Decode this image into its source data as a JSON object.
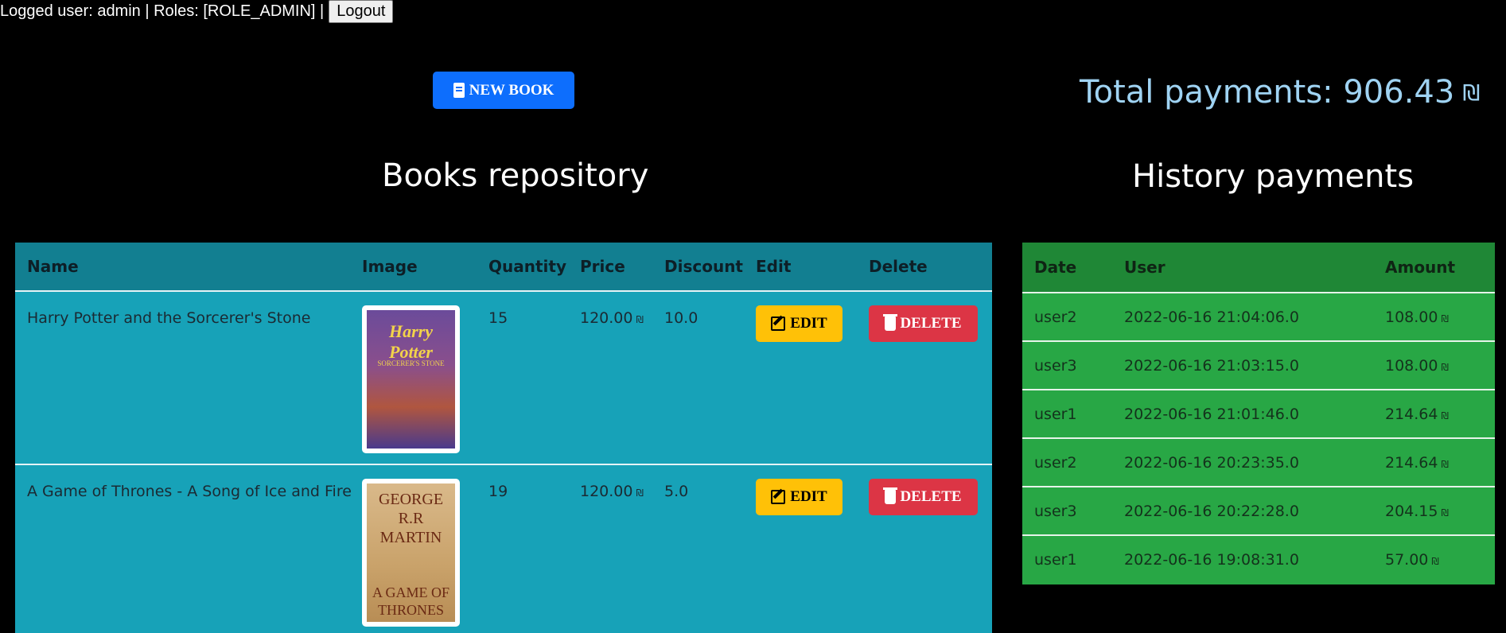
{
  "header": {
    "user_info": "Logged user: admin | Roles: [ROLE_ADMIN] |",
    "logout_label": "Logout"
  },
  "actions": {
    "new_book_label": "NEW BOOK"
  },
  "summary": {
    "total_payments_label": "Total payments: 906.43",
    "currency_symbol": "₪"
  },
  "books": {
    "title": "Books repository",
    "columns": [
      "Name",
      "Image",
      "Quantity",
      "Price",
      "Discount",
      "Edit",
      "Delete"
    ],
    "edit_label": "EDIT",
    "delete_label": "DELETE",
    "rows": [
      {
        "name": "Harry Potter and the Sorcerer's Stone",
        "quantity": "15",
        "price": "120.00",
        "discount": "10.0",
        "cover_top": "Harry Potter",
        "cover_bottom": "SORCERER'S STONE"
      },
      {
        "name": "A Game of Thrones - A Song of Ice and Fire",
        "quantity": "19",
        "price": "120.00",
        "discount": "5.0",
        "cover_top": "GEORGE R.R MARTIN",
        "cover_bottom": "A GAME OF THRONES"
      }
    ]
  },
  "payments": {
    "title": "History payments",
    "columns": [
      "Date",
      "User",
      "Amount"
    ],
    "rows": [
      {
        "date": "user2",
        "user": "2022-06-16 21:04:06.0",
        "amount": "108.00"
      },
      {
        "date": "user3",
        "user": "2022-06-16 21:03:15.0",
        "amount": "108.00"
      },
      {
        "date": "user1",
        "user": "2022-06-16 21:01:46.0",
        "amount": "214.64"
      },
      {
        "date": "user2",
        "user": "2022-06-16 20:23:35.0",
        "amount": "214.64"
      },
      {
        "date": "user3",
        "user": "2022-06-16 20:22:28.0",
        "amount": "204.15"
      },
      {
        "date": "user1",
        "user": "2022-06-16 19:08:31.0",
        "amount": "57.00"
      }
    ]
  },
  "colors": {
    "accent_primary": "#0d6efd",
    "books_table_bg": "#17a2b8",
    "payments_table_bg": "#28a745",
    "edit_button": "#ffc107",
    "delete_button": "#dc3545",
    "total_text": "#9fd3f3"
  }
}
